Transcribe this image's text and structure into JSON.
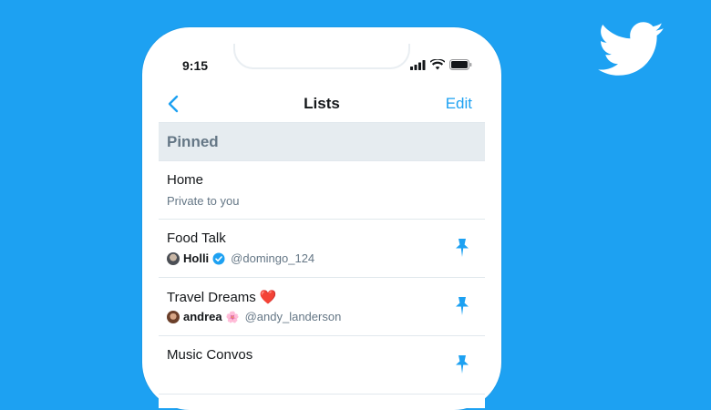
{
  "brand": {
    "logo_icon": "twitter-bird-icon",
    "background": "#1da1f2",
    "accent": "#1da1f2"
  },
  "status_bar": {
    "time": "9:15"
  },
  "nav": {
    "title": "Lists",
    "edit_label": "Edit",
    "back_icon": "chevron-left-icon"
  },
  "section": {
    "title": "Pinned"
  },
  "lists": [
    {
      "title": "Home",
      "subtitle": "Private to you"
    },
    {
      "title": "Food Talk",
      "owner": {
        "name": "Holli",
        "handle": "@domingo_124",
        "verified": true
      },
      "pinned": true
    },
    {
      "title": "Travel Dreams",
      "title_emoji": "❤️",
      "owner": {
        "name": "andrea",
        "handle": "@andy_landerson",
        "badge_emoji": "🌸"
      },
      "pinned": true
    },
    {
      "title": "Music Convos",
      "pinned": true
    }
  ]
}
